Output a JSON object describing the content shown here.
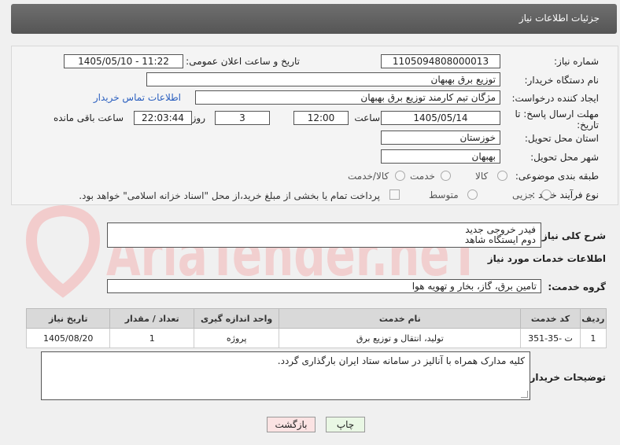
{
  "header": {
    "title": "جزئیات اطلاعات نیاز"
  },
  "form": {
    "need_number_label": "شماره نیاز:",
    "need_number": "1105094808000013",
    "announce_label": "تاریخ و ساعت اعلان عمومی:",
    "announce_value": "1405/05/10 - 11:22",
    "buyer_org_label": "نام دستگاه خریدار:",
    "buyer_org": "توزیع برق بهبهان",
    "creator_label": "ایجاد کننده درخواست:",
    "creator": "مژگان تیم کارمند توزیع برق بهبهان",
    "contact_link": "اطلاعات تماس خریدار",
    "deadline_label_1": "مهلت ارسال پاسخ: تا",
    "deadline_label_2": "تاریخ:",
    "deadline_date": "1405/05/14",
    "time_label": "ساعت",
    "deadline_time": "12:00",
    "days_value": "3",
    "days_label": "روز و",
    "remaining_time": "22:03:44",
    "remaining_label": "ساعت باقی مانده",
    "province_label": "استان محل تحویل:",
    "province": "خوزستان",
    "city_label": "شهر محل تحویل:",
    "city": "بهبهان",
    "category_label": "طبقه بندی موضوعی:",
    "category_options": [
      "کالا",
      "خدمت",
      "کالا/خدمت"
    ],
    "process_label": "نوع فرآیند خرید :",
    "process_options": [
      "جزیی",
      "متوسط"
    ],
    "payment_note": "پرداخت تمام یا بخشی از مبلغ خرید،از محل \"اسناد خزانه اسلامی\" خواهد بود."
  },
  "description": {
    "label": "شرح کلی نیاز:",
    "line1": "فیدر خروجی جدید",
    "line2": "دوم ایستگاه شاهد"
  },
  "services": {
    "section_title": "اطلاعات خدمات مورد نیاز",
    "group_label": "گروه خدمت:",
    "group_value": "تامین برق، گاز، بخار و تهویه هوا",
    "columns": [
      "ردیف",
      "کد خدمت",
      "نام خدمت",
      "واحد اندازه گیری",
      "تعداد / مقدار",
      "تاریخ نیاز"
    ],
    "rows": [
      {
        "row": "1",
        "code": "ت -35-351",
        "name": "تولید، انتقال و توزیع برق",
        "unit": "پروژه",
        "qty": "1",
        "date": "1405/08/20"
      }
    ]
  },
  "buyer_notes": {
    "label": "توضیحات خریدار:",
    "text": "کلیه مدارک همراه با آنالیز در سامانه ستاد ایران بارگذاری گردد."
  },
  "buttons": {
    "print": "چاپ",
    "back": "بازگشت"
  },
  "watermark": {
    "text": "AriaTender.neT"
  },
  "colors": {
    "header_bg": "#5f5f5f",
    "link": "#2a5fbf",
    "print_btn": "#e9f7e4",
    "back_btn": "#fbe3e3",
    "watermark": "#f2cccc"
  }
}
